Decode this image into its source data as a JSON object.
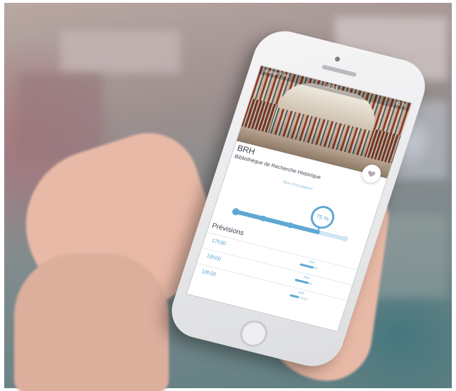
{
  "status_bar": {
    "carrier": "orange F  4G",
    "time": "17:25",
    "battery": "81 %"
  },
  "place": {
    "code": "BRH",
    "name": "Bibliothèque de Recherche Historique"
  },
  "occupancy": {
    "label": "Taux d'occupation",
    "value_text": "75 %",
    "level": 0.75
  },
  "forecast": {
    "title": "Prévisions",
    "rows": [
      {
        "time": "17h30",
        "percent": "75%",
        "level": 0.75
      },
      {
        "time": "18h00",
        "percent": "75%",
        "level": 0.75
      },
      {
        "time": "18h30",
        "percent": "50%",
        "level": 0.5
      }
    ]
  },
  "icons": {
    "favorite": "heart-icon"
  },
  "colors": {
    "accent": "#5ea8d4",
    "accent_light": "#cfe6f4",
    "text": "#3d4450",
    "phone": "#e9eaec"
  }
}
